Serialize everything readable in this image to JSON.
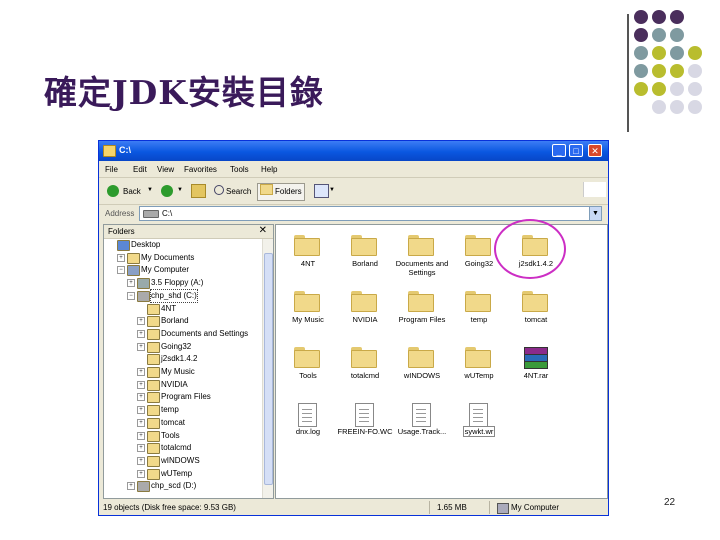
{
  "slide": {
    "title": "確定JDK安裝目錄",
    "page_number": "22",
    "dot_colors": [
      "#4a2e5c",
      "#7f9aa0",
      "#b9bd2e",
      "#d8d8e4"
    ]
  },
  "window": {
    "title": "C:\\",
    "controls": {
      "minimize": "_",
      "maximize": "□",
      "close": "✕"
    },
    "menu": [
      "File",
      "Edit",
      "View",
      "Favorites",
      "Tools",
      "Help"
    ],
    "toolbar": {
      "back_label": "Back",
      "search_label": "Search",
      "folders_label": "Folders"
    },
    "address": {
      "label": "Address",
      "value": "C:\\"
    },
    "folders_pane": {
      "title": "Folders",
      "close": "✕",
      "tree": [
        {
          "label": "Desktop",
          "icon": "desktop-icon",
          "expander": "",
          "level": 0
        },
        {
          "label": "My Documents",
          "icon": "folder-icon",
          "expander": "+",
          "level": 1
        },
        {
          "label": "My Computer",
          "icon": "computer-icon",
          "expander": "−",
          "level": 1
        },
        {
          "label": "3.5 Floppy (A:)",
          "icon": "floppy-icon",
          "expander": "+",
          "level": 2
        },
        {
          "label": "chp_shd (C:)",
          "icon": "drive-icon",
          "expander": "−",
          "level": 2,
          "selected": true
        },
        {
          "label": "4NT",
          "icon": "folder-icon",
          "expander": "",
          "level": 3
        },
        {
          "label": "Borland",
          "icon": "folder-icon",
          "expander": "+",
          "level": 3
        },
        {
          "label": "Documents and Settings",
          "icon": "folder-icon",
          "expander": "+",
          "level": 3
        },
        {
          "label": "Going32",
          "icon": "folder-icon",
          "expander": "+",
          "level": 3
        },
        {
          "label": "j2sdk1.4.2",
          "icon": "folder-icon",
          "expander": "",
          "level": 3
        },
        {
          "label": "My Music",
          "icon": "folder-icon",
          "expander": "+",
          "level": 3
        },
        {
          "label": "NVIDIA",
          "icon": "folder-icon",
          "expander": "+",
          "level": 3
        },
        {
          "label": "Program Files",
          "icon": "folder-icon",
          "expander": "+",
          "level": 3
        },
        {
          "label": "temp",
          "icon": "folder-icon",
          "expander": "+",
          "level": 3
        },
        {
          "label": "tomcat",
          "icon": "folder-icon",
          "expander": "+",
          "level": 3
        },
        {
          "label": "Tools",
          "icon": "folder-icon",
          "expander": "+",
          "level": 3
        },
        {
          "label": "totalcmd",
          "icon": "folder-icon",
          "expander": "+",
          "level": 3
        },
        {
          "label": "wINDOWS",
          "icon": "folder-icon",
          "expander": "+",
          "level": 3
        },
        {
          "label": "wUTemp",
          "icon": "folder-icon",
          "expander": "+",
          "level": 3
        },
        {
          "label": "chp_scd (D:)",
          "icon": "drive-icon",
          "expander": "+",
          "level": 2
        }
      ]
    },
    "content_items": [
      {
        "label": "4NT",
        "type": "folder"
      },
      {
        "label": "Borland",
        "type": "folder"
      },
      {
        "label": "Documents and Settings",
        "type": "folder"
      },
      {
        "label": "Going32",
        "type": "folder"
      },
      {
        "label": "j2sdk1.4.2",
        "type": "folder",
        "highlighted": true
      },
      {
        "label": "My Music",
        "type": "folder"
      },
      {
        "label": "NVIDIA",
        "type": "folder"
      },
      {
        "label": "Program Files",
        "type": "folder"
      },
      {
        "label": "temp",
        "type": "folder"
      },
      {
        "label": "tomcat",
        "type": "folder"
      },
      {
        "label": "Tools",
        "type": "folder"
      },
      {
        "label": "totalcmd",
        "type": "folder"
      },
      {
        "label": "wINDOWS",
        "type": "folder"
      },
      {
        "label": "wUTemp",
        "type": "folder"
      },
      {
        "label": "4NT.rar",
        "type": "rar"
      },
      {
        "label": "dnx.log",
        "type": "doc"
      },
      {
        "label": "FREEIN-FO.WC",
        "type": "doc"
      },
      {
        "label": "Usage.Track...",
        "type": "doc"
      },
      {
        "label": "sywkt.wr",
        "type": "doc",
        "boxed": true
      }
    ],
    "status": {
      "objects": "19 objects (Disk free space: 9.53 GB)",
      "size": "1.65 MB",
      "location": "My Computer"
    }
  }
}
